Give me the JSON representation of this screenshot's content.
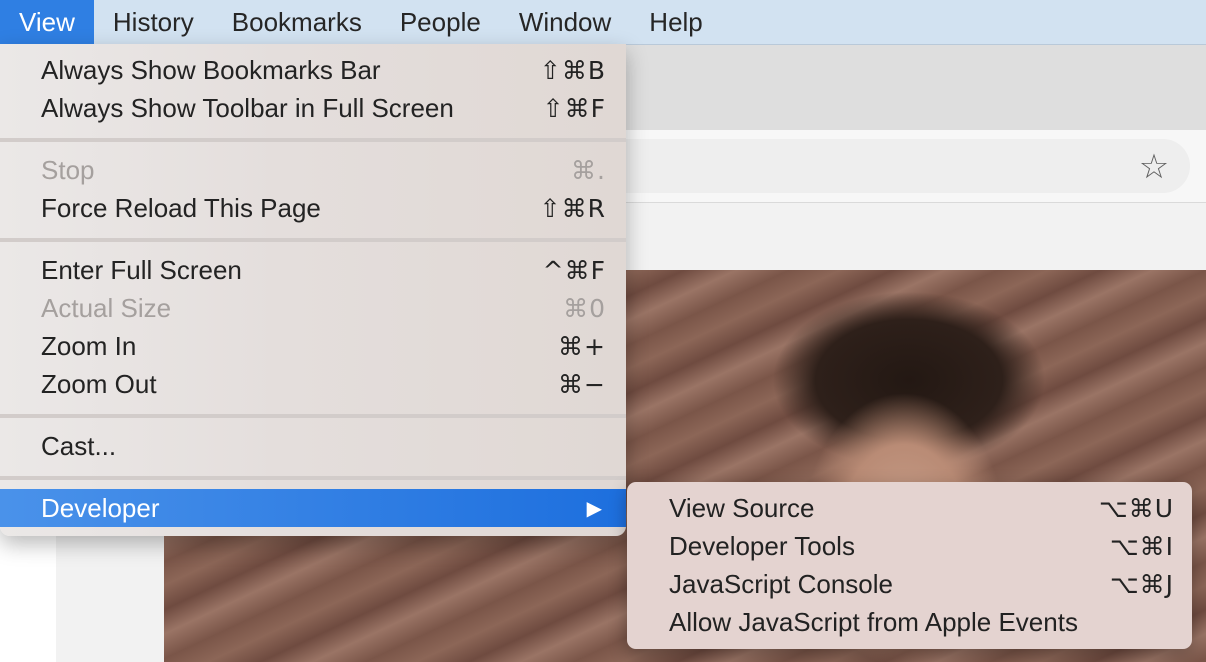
{
  "menubar": {
    "items": [
      {
        "label": "View",
        "active": true
      },
      {
        "label": "History"
      },
      {
        "label": "Bookmarks"
      },
      {
        "label": "People"
      },
      {
        "label": "Window"
      },
      {
        "label": "Help"
      }
    ]
  },
  "browser": {
    "star_icon": "star-icon"
  },
  "view_menu": {
    "items": [
      {
        "label": "Always Show Bookmarks Bar",
        "shortcut": "⇧⌘B"
      },
      {
        "label": "Always Show Toolbar in Full Screen",
        "shortcut": "⇧⌘F"
      },
      {
        "label": "Stop",
        "shortcut": "⌘.",
        "disabled": true
      },
      {
        "label": "Force Reload This Page",
        "shortcut": "⇧⌘R"
      },
      {
        "label": "Enter Full Screen",
        "shortcut": "^⌘F"
      },
      {
        "label": "Actual Size",
        "shortcut": "⌘0",
        "disabled": true
      },
      {
        "label": "Zoom In",
        "shortcut": "⌘+"
      },
      {
        "label": "Zoom Out",
        "shortcut": "⌘−"
      },
      {
        "label": "Cast..."
      },
      {
        "label": "Developer",
        "submenu_arrow": "▶",
        "highlighted": true
      }
    ]
  },
  "developer_submenu": {
    "items": [
      {
        "label": "View Source",
        "shortcut": "⌥⌘U"
      },
      {
        "label": "Developer Tools",
        "shortcut": "⌥⌘I"
      },
      {
        "label": "JavaScript Console",
        "shortcut": "⌥⌘J"
      },
      {
        "label": "Allow JavaScript from Apple Events"
      }
    ]
  },
  "colors": {
    "menubar_bg": "#d2e2f1",
    "active_menu": "#2f7fe3",
    "highlight": "#1d6fde"
  }
}
